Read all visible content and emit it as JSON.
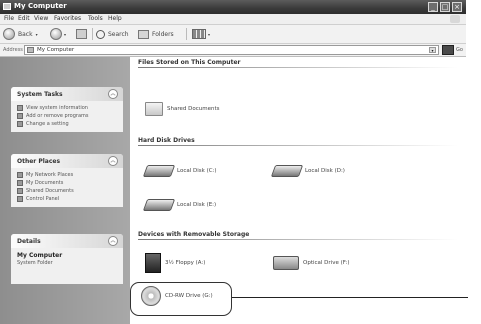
{
  "window": {
    "title": "My Computer",
    "minimize": "_",
    "maximize": "□",
    "close": "×"
  },
  "menu": [
    "File",
    "Edit",
    "View",
    "Favorites",
    "Tools",
    "Help"
  ],
  "toolbar": {
    "back": "Back",
    "search": "Search",
    "folders": "Folders"
  },
  "address": {
    "label": "Address",
    "value": "My Computer",
    "go": "Go"
  },
  "sidebar": {
    "system_tasks": {
      "title": "System Tasks",
      "items": [
        "View system information",
        "Add or remove programs",
        "Change a setting"
      ]
    },
    "other_places": {
      "title": "Other Places",
      "items": [
        "My Network Places",
        "My Documents",
        "Shared Documents",
        "Control Panel"
      ]
    },
    "details": {
      "title": "Details",
      "name": "My Computer",
      "desc": "System Folder"
    }
  },
  "groups": {
    "files": {
      "title": "Files Stored on This Computer",
      "items": [
        "Shared Documents"
      ]
    },
    "hdd": {
      "title": "Hard Disk Drives",
      "items": [
        "Local Disk (C:)",
        "Local Disk (D:)",
        "Local Disk (E:)"
      ]
    },
    "removable": {
      "title": "Devices with Removable Storage",
      "items": [
        "3½ Floppy (A:)",
        "Optical Drive (F:)",
        "CD-RW Drive (G:)"
      ]
    }
  }
}
